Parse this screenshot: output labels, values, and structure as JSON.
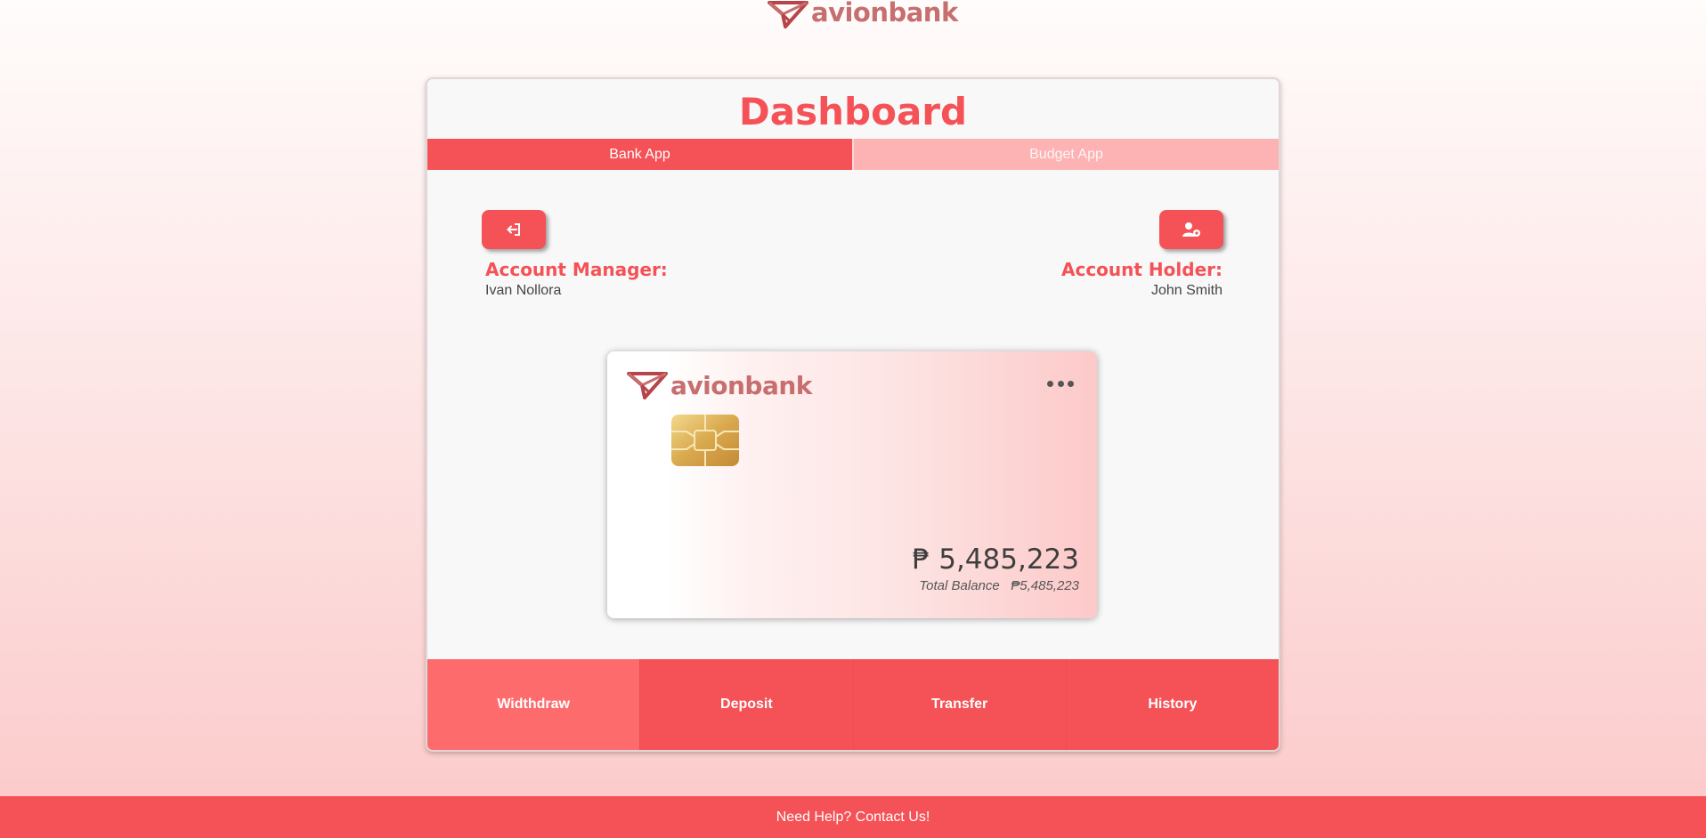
{
  "brand": {
    "name": "avionbank",
    "logo_icon": "paper-plane-icon",
    "colors": {
      "primary": "#f45257",
      "primary_light": "#fdb3b3",
      "active_action": "#fd6b6d",
      "logo_text": "#c76e6e"
    }
  },
  "header": {
    "title": "Dashboard"
  },
  "tabs": [
    {
      "label": "Bank App",
      "active": true
    },
    {
      "label": "Budget App",
      "active": false
    }
  ],
  "buttons": {
    "logout_icon": "logout-icon",
    "profile_icon": "user-settings-icon"
  },
  "account": {
    "manager_label": "Account Manager:",
    "manager_name": "Ivan Nollora",
    "holder_label": "Account Holder:",
    "holder_name": "John Smith"
  },
  "card": {
    "menu_icon": "more-horizontal-icon",
    "chip_icon": "chip-icon",
    "balance": "₱ 5,485,223",
    "total_label": "Total Balance",
    "total_value": "₱5,485,223"
  },
  "actions": [
    {
      "label": "Widthdraw",
      "active": true
    },
    {
      "label": "Deposit",
      "active": false
    },
    {
      "label": "Transfer",
      "active": false
    },
    {
      "label": "History",
      "active": false
    }
  ],
  "footer": {
    "help_text": "Need Help? Contact Us!"
  }
}
